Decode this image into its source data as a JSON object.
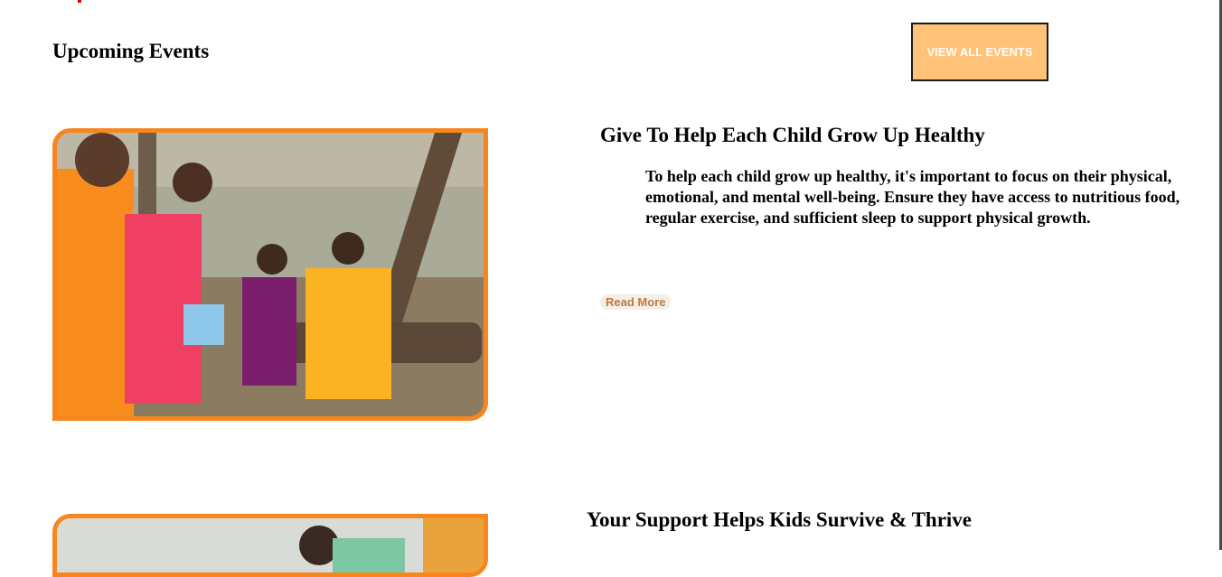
{
  "events_section": {
    "title": "Upcoming Events",
    "view_all_label": "VIEW ALL EVENTS"
  },
  "events": [
    {
      "title": "Give To Help Each Child Grow Up Healthy",
      "description": "To help each child grow up healthy, it's important to focus on their physical, emotional, and mental well-being. Ensure they have access to nutritious food, regular exercise, and sufficient sleep to support physical growth.",
      "read_more_label": "Read More"
    },
    {
      "title": "Your Support Helps Kids Survive & Thrive"
    }
  ],
  "colors": {
    "accent_orange": "#f7861f",
    "button_fill": "#ffc278",
    "read_more_text": "#c17a3a",
    "top_red": "#e10600"
  }
}
